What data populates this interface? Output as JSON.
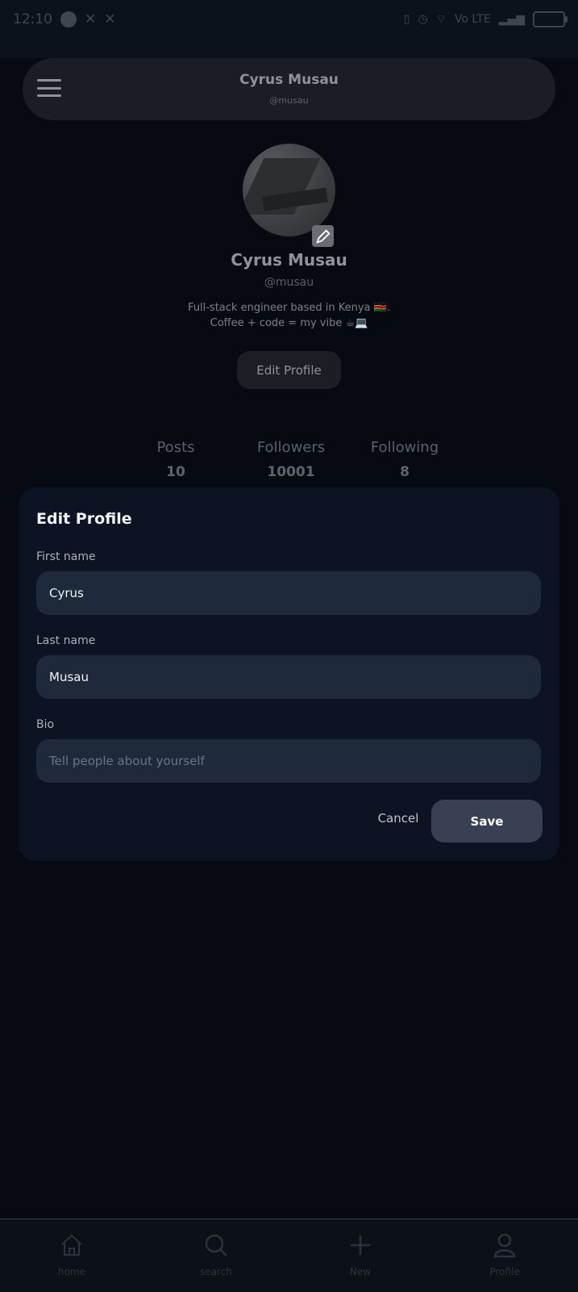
{
  "status_bar": {
    "time": "12:10",
    "network": "Vo LTE"
  },
  "header": {
    "title": "Cyrus  Musau",
    "subtitle": "@musau"
  },
  "profile": {
    "name": "Cyrus  Musau",
    "handle": "@musau",
    "bio_line1": "Full-stack engineer based in Kenya 🇰🇪.",
    "bio_line2": "Coffee + code = my vibe ☕💻",
    "edit_button": "Edit Profile"
  },
  "stats": [
    {
      "label": "Posts",
      "value": "10"
    },
    {
      "label": "Followers",
      "value": "10001"
    },
    {
      "label": "Following",
      "value": "8"
    }
  ],
  "modal": {
    "title": "Edit Profile",
    "first_name_label": "First name",
    "first_name_value": "Cyrus",
    "last_name_label": "Last name",
    "last_name_value": "Musau",
    "bio_label": "Bio",
    "bio_placeholder": "Tell people about yourself",
    "cancel": "Cancel",
    "save": "Save"
  },
  "nav": [
    {
      "label": "home",
      "icon": "home-icon"
    },
    {
      "label": "search",
      "icon": "search-icon"
    },
    {
      "label": "New",
      "icon": "plus-icon"
    },
    {
      "label": "Profile",
      "icon": "person-icon"
    }
  ],
  "colors": {
    "background": "#070b11",
    "modal": "#0c1322",
    "field": "#1e293b",
    "save_button": "#374153"
  }
}
